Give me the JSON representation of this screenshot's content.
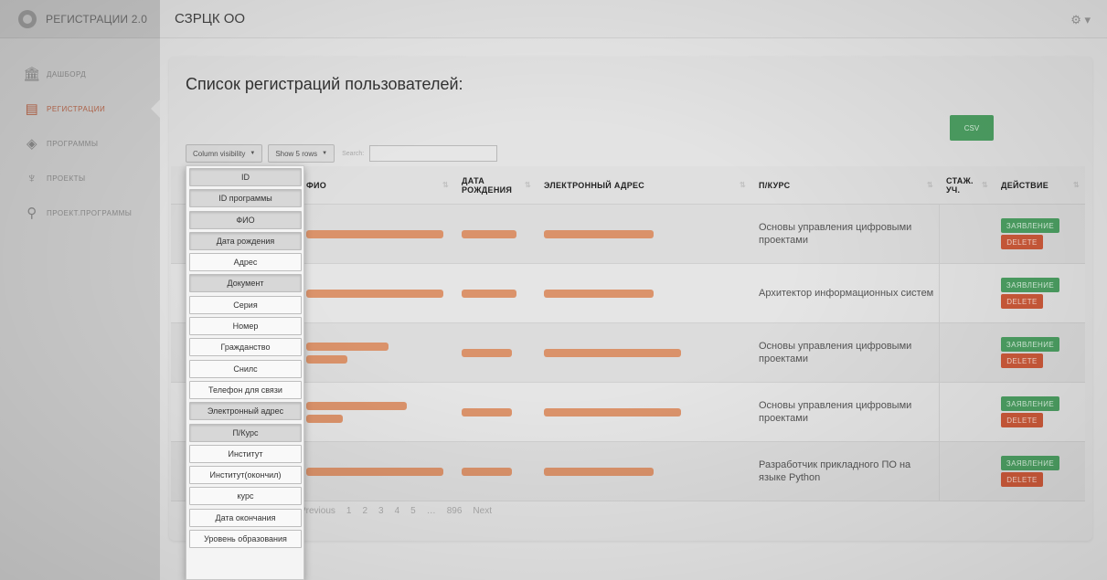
{
  "brand": {
    "name": "РЕГИСТРАЦИИ 2.0"
  },
  "topbar": {
    "title": "СЗРЦК ОО"
  },
  "sidebar": {
    "items": [
      {
        "label": "ДАШБОРД",
        "icon": "bank-icon",
        "glyph": "🏛"
      },
      {
        "label": "РЕГИСТРАЦИИ",
        "icon": "list-icon",
        "glyph": "▤",
        "active": true
      },
      {
        "label": "ПРОГРАММЫ",
        "icon": "diamond-icon",
        "glyph": "◈"
      },
      {
        "label": "ПРОЕКТЫ",
        "icon": "trophy-icon",
        "glyph": "♆"
      },
      {
        "label": "ПРОЕКТ.ПРОГРАММЫ",
        "icon": "user-icon",
        "glyph": "⚲"
      }
    ]
  },
  "page": {
    "title": "Список регистраций пользователей:",
    "csv_label": "CSV",
    "column_visibility_label": "Column visibility",
    "show_rows_label": "Show 5 rows",
    "search_label": "Search:"
  },
  "table": {
    "headers": {
      "fio": "ФИО",
      "dob": "ДАТА РОЖДЕНИЯ",
      "email": "ЭЛЕКТРОННЫЙ АДРЕС",
      "course": "П/КУРС",
      "stazh": "СТАЖ. УЧ.",
      "action": "ДЕЙСТВИЕ"
    },
    "rows": [
      {
        "course": "Основы управления цифровыми проектами"
      },
      {
        "course": "Архитектор информационных систем"
      },
      {
        "course": "Основы управления цифровыми проектами"
      },
      {
        "course": "Основы управления цифровыми проектами"
      },
      {
        "course": "Разработчик прикладного ПО на языке Python"
      }
    ],
    "apply_label": "ЗАЯВЛЕНИЕ",
    "delete_label": "DELETE"
  },
  "pagination": {
    "previous": "Previous",
    "pages": [
      "1",
      "2",
      "3",
      "4",
      "5",
      "…",
      "896"
    ],
    "next": "Next"
  },
  "column_visibility": [
    {
      "label": "ID",
      "on": true
    },
    {
      "label": "ID программы",
      "on": true
    },
    {
      "label": "ФИО",
      "on": true
    },
    {
      "label": "Дата рождения",
      "on": true
    },
    {
      "label": "Адрес",
      "on": false
    },
    {
      "label": "Документ",
      "on": true
    },
    {
      "label": "Серия",
      "on": false
    },
    {
      "label": "Номер",
      "on": false
    },
    {
      "label": "Гражданство",
      "on": false
    },
    {
      "label": "Снилс",
      "on": false
    },
    {
      "label": "Телефон для связи",
      "on": false
    },
    {
      "label": "Электронный адрес",
      "on": true
    },
    {
      "label": "П/Курс",
      "on": true
    },
    {
      "label": "Институт",
      "on": false
    },
    {
      "label": "Институт(окончил)",
      "on": false
    },
    {
      "label": "курс",
      "on": false
    },
    {
      "label": "Дата окончания",
      "on": false
    },
    {
      "label": "Уровень образования",
      "on": false
    }
  ],
  "colors": {
    "success": "#4da063",
    "danger": "#cd5a3a",
    "redaction": "#d98556",
    "active_nav": "#b8674b"
  }
}
